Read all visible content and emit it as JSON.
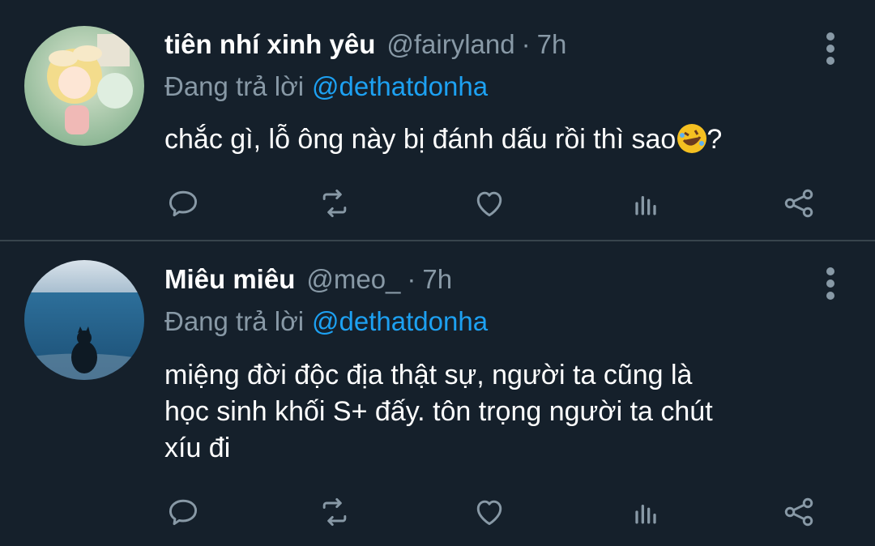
{
  "tweets": [
    {
      "name": "tiên nhí xinh yêu",
      "handle": "@fairyland",
      "separator": "·",
      "time": "7h",
      "replying_prefix": "Đang trả lời",
      "replying_to": "@dethatdonha",
      "text": "chắc gì, lỗ ông này bị đánh dấu rồi thì sao",
      "text_suffix": "?",
      "emoji": "rolling-on-floor-laughing"
    },
    {
      "name": "Miêu miêu",
      "handle": "@meo_",
      "separator": "·",
      "time": "7h",
      "replying_prefix": "Đang trả lời",
      "replying_to": "@dethatdonha",
      "text_lines": [
        "miệng đời độc địa thật sự, người ta cũng là",
        "học sinh khối S+ đấy. tôn trọng người ta chút",
        "xíu đi"
      ]
    }
  ],
  "colors": {
    "background": "#15202b",
    "secondary_text": "#8899a6",
    "mention": "#1da1f2",
    "divider": "#38444d"
  },
  "icons": [
    "reply-icon",
    "retweet-icon",
    "like-icon",
    "analytics-icon",
    "share-icon",
    "more-icon"
  ]
}
